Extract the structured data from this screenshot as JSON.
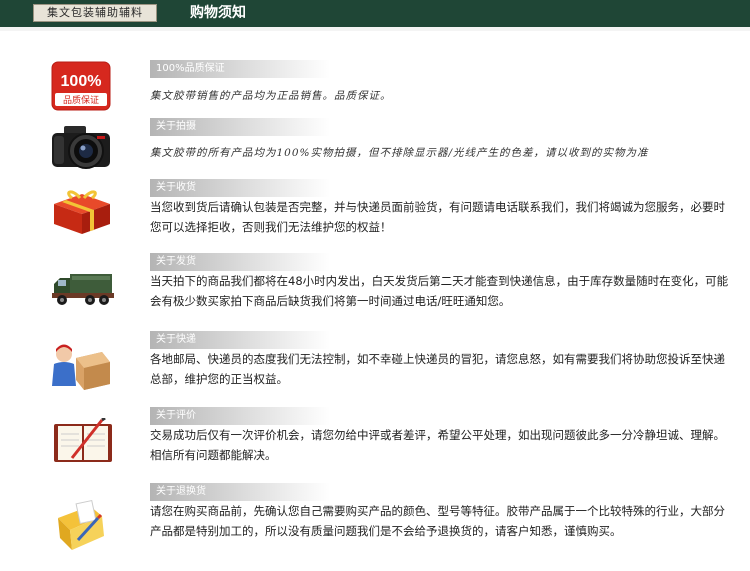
{
  "header": {
    "logo_text": "集文包装辅助辅料",
    "title": "购物须知"
  },
  "sections": [
    {
      "label": "100%品质保证",
      "text": "集文胶带销售的产品均为正品销售。品质保证。",
      "icon": "quality-badge-icon",
      "badge_top": "100%",
      "badge_bottom": "品质保证"
    },
    {
      "label": "关于拍摄",
      "text": "集文胶带的所有产品均为100%实物拍摄，但不排除显示器/光线产生的色差，请以收到的实物为准",
      "icon": "camera-icon"
    },
    {
      "label": "关于收货",
      "text": "当您收到货后请确认包装是否完整，并与快递员面前验货，有问题请电话联系我们，我们将竭诚为您服务，必要时您可以选择拒收，否则我们无法维护您的权益！",
      "icon": "gift-box-icon"
    },
    {
      "label": "关于发货",
      "text": "当天拍下的商品我们都将在48小时内发出，白天发货后第二天才能查到快递信息，由于库存数量随时在变化，可能会有极少数买家拍下商品后缺货我们将第一时间通过电话/旺旺通知您。",
      "icon": "truck-icon"
    },
    {
      "label": "关于快递",
      "text": "各地邮局、快递员的态度我们无法控制，如不幸碰上快递员的冒犯，请您息怒，如有需要我们将协助您投诉至快递总部，维护您的正当权益。",
      "icon": "courier-icon"
    },
    {
      "label": "关于评价",
      "text": "交易成功后仅有一次评价机会，请您勿给中评或者差评，希望公平处理，如出现问题彼此多一分冷静坦诚、理解。相信所有问题都能解决。",
      "icon": "notebook-icon"
    },
    {
      "label": "关于退换货",
      "text": "请您在购买商品前，先确认您自己需要购买产品的颜色、型号等特征。胶带产品属于一个比较特殊的行业，大部分产品都是特别加工的，所以没有质量问题我们是不会给予退换货的，请客户知悉，谨慎购买。",
      "icon": "folder-icon"
    }
  ]
}
